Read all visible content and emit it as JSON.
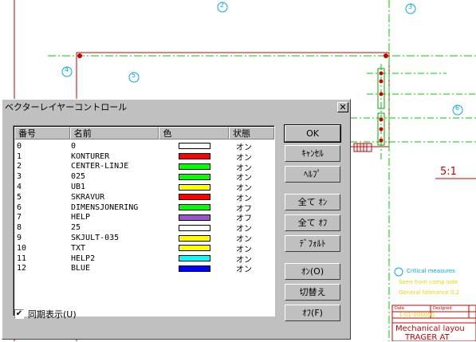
{
  "cad": {
    "balloons": [
      "2",
      "3",
      "4",
      "5",
      "6"
    ],
    "scale_label": "5:1",
    "notes": [
      "Critical measures",
      "Seen from comp side",
      "General tolerance 0.2"
    ],
    "title_block": {
      "headers": [
        "Date",
        "Designed"
      ],
      "drawing_no": "1-01-000000",
      "title1": "Mechanical layou",
      "title2": "TRAGER AT"
    }
  },
  "dialog": {
    "title": "ベクターレイヤーコントロール",
    "close_label": "✕",
    "columns": {
      "no": "番号",
      "name": "名前",
      "color": "色",
      "state": "状態"
    },
    "layers": [
      {
        "no": "0",
        "name": "0",
        "color": "#ffffff",
        "state": "オン"
      },
      {
        "no": "1",
        "name": "KONTURER",
        "color": "#ff0000",
        "state": "オン"
      },
      {
        "no": "2",
        "name": "CENTER-LINJE",
        "color": "#00ff00",
        "state": "オン"
      },
      {
        "no": "3",
        "name": "025",
        "color": "#00ff00",
        "state": "オン"
      },
      {
        "no": "4",
        "name": "UB1",
        "color": "#ffff00",
        "state": "オン"
      },
      {
        "no": "5",
        "name": "SKRAVUR",
        "color": "#ff0000",
        "state": "オン"
      },
      {
        "no": "6",
        "name": "DIMENSJONERING",
        "color": "#00ff00",
        "state": "オフ"
      },
      {
        "no": "7",
        "name": "HELP",
        "color": "#9955cc",
        "state": "オフ"
      },
      {
        "no": "8",
        "name": "25",
        "color": "#ffffff",
        "state": "オン"
      },
      {
        "no": "9",
        "name": "SKJULT-035",
        "color": "#ffff00",
        "state": "オン"
      },
      {
        "no": "10",
        "name": "TXT",
        "color": "#ffff00",
        "state": "オン"
      },
      {
        "no": "11",
        "name": "HELP2",
        "color": "#00ffff",
        "state": "オン"
      },
      {
        "no": "12",
        "name": "BLUE",
        "color": "#0000ff",
        "state": "オン"
      }
    ],
    "sync_label": "同期表示(U)",
    "sync_checked": true,
    "buttons": {
      "ok": "OK",
      "cancel": "ｷｬﾝｾﾙ",
      "help": "ﾍﾙﾌﾟ",
      "all_on": "全て ｵﾝ",
      "all_off": "全て ｵﾌ",
      "default": "ﾃﾞﾌｫﾙﾄ",
      "on": "ｵﾝ(O)",
      "toggle": "切替え",
      "off": "ｵﾌ(F)"
    }
  }
}
